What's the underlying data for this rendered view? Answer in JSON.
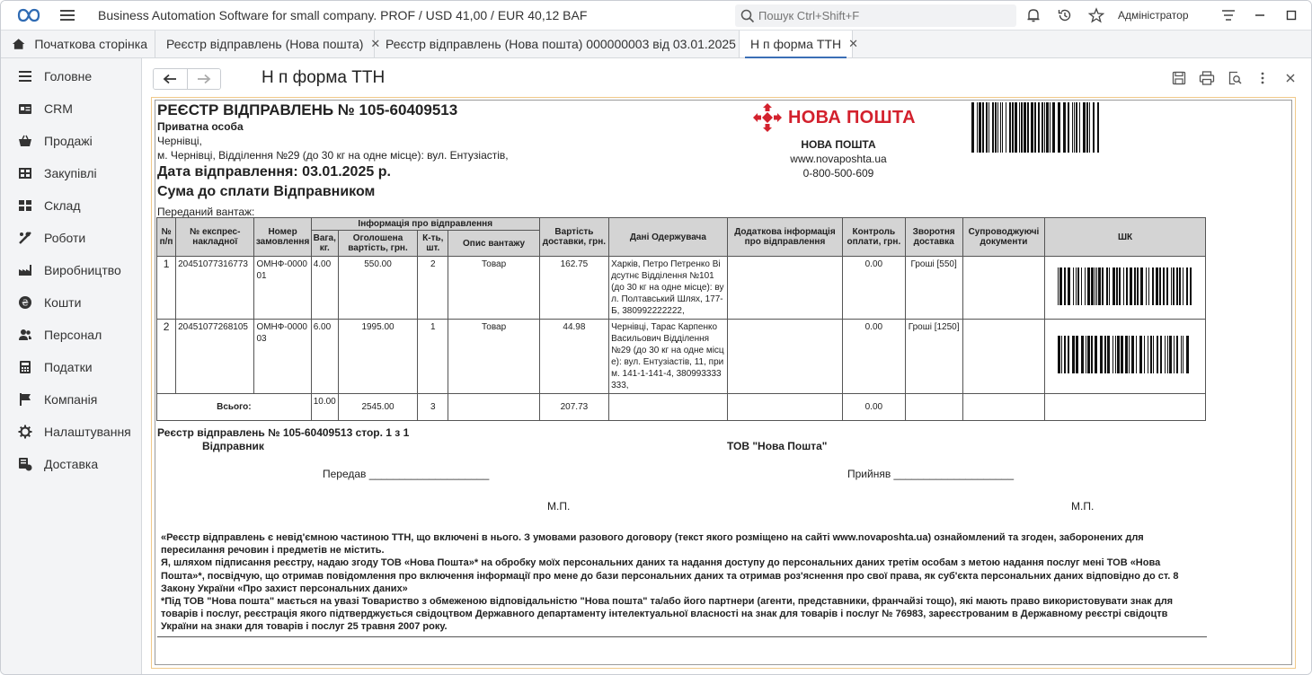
{
  "app": {
    "title": "Business Automation Software for small company. PROF / USD 41,00 / EUR 40,12 BAF",
    "search_placeholder": "Пошук Ctrl+Shift+F",
    "user": "Адміністратор"
  },
  "tabs": [
    {
      "label": "Початкова сторінка",
      "icon": "home-icon"
    },
    {
      "label": "Реєстр відправлень (Нова пошта)",
      "close": "✕"
    },
    {
      "label": "Реєстр відправлень (Нова пошта) 000000003 від 03.01.2025",
      "close": "✕"
    },
    {
      "label": "Н п форма ТТН",
      "close": "✕",
      "active": true
    }
  ],
  "sidebar": {
    "items": [
      {
        "label": "Головне",
        "icon": "menu-lines-icon"
      },
      {
        "label": "CRM",
        "icon": "crm-card-icon"
      },
      {
        "label": "Продажі",
        "icon": "basket-icon"
      },
      {
        "label": "Закупівлі",
        "icon": "cart-icon"
      },
      {
        "label": "Склад",
        "icon": "warehouse-icon"
      },
      {
        "label": "Роботи",
        "icon": "tools-icon"
      },
      {
        "label": "Виробництво",
        "icon": "factory-icon"
      },
      {
        "label": "Кошти",
        "icon": "money-icon"
      },
      {
        "label": "Персонал",
        "icon": "people-icon"
      },
      {
        "label": "Податки",
        "icon": "calculator-icon"
      },
      {
        "label": "Компанія",
        "icon": "flag-icon"
      },
      {
        "label": "Налаштування",
        "icon": "gear-icon"
      },
      {
        "label": "Доставка",
        "icon": "delivery-icon"
      }
    ]
  },
  "content": {
    "title": "Н п форма ТТН"
  },
  "document": {
    "title": "РЕЄСТР ВІДПРАВЛЕНЬ № 105-60409513",
    "sender_type": "Приватна особа",
    "city": "Чернівці,",
    "address": "м. Чернівці, Відділення №29 (до 30 кг на одне місце): вул. Ентузіастів,",
    "date": "Дата відправлення: 03.01.2025 р.",
    "payer": "Сума до сплати Відправником",
    "cargo_label": "Переданий вантаж:",
    "np_logo_text": "НОВА ПОШТА",
    "np_name": "НОВА ПОШТА",
    "np_site": "www.novaposhta.ua",
    "np_phone": "0-800-500-609",
    "colors": {
      "np_red": "#d3212d",
      "frame": "#f0c98a",
      "header_bg": "#d4d4d4"
    },
    "table": {
      "headers": {
        "num": "№ п/п",
        "express": "№ експрес-накладної",
        "order": "Номер замовлення",
        "info_group": "Інформація про відправлення",
        "weight": "Вага, кг.",
        "declared": "Оголошена вартість, грн.",
        "qty": "К-ть, шт.",
        "desc": "Опис вантажу",
        "cost": "Вартість доставки, грн.",
        "recipient": "Дані Одержувача",
        "extra": "Додаткова інформація про відправлення",
        "cod": "Контроль оплати, грн.",
        "return": "Зворотня доставка",
        "docs": "Супроводжуючі документи",
        "barcode": "ШК"
      },
      "rows": [
        {
          "num": "1",
          "express": "20451077316773",
          "order": "ОМНФ-000001",
          "weight": "4.00",
          "declared": "550.00",
          "qty": "2",
          "desc": "Товар",
          "cost": "162.75",
          "recipient": "Харків, Петро Петренко Відсутнє Відділення №101 (до 30 кг на одне місце): вул. Полтавський Шлях, 177-Б, 380992222222,",
          "extra": "",
          "cod": "0.00",
          "return": "Гроші [550]",
          "docs": ""
        },
        {
          "num": "2",
          "express": "20451077268105",
          "order": "ОМНФ-000003",
          "weight": "6.00",
          "declared": "1995.00",
          "qty": "1",
          "desc": "Товар",
          "cost": "44.98",
          "recipient": "Чернівці, Тарас Карпенко Васильович Відділення №29 (до 30 кг на одне місце): вул. Ентузіастів, 11, прим. 141-1-141-4, 380993333333,",
          "extra": "",
          "cod": "0.00",
          "return": "Гроші [1250]",
          "docs": ""
        }
      ],
      "totals": {
        "label": "Всього:",
        "weight": "10.00",
        "declared": "2545.00",
        "qty": "3",
        "cost": "207.73",
        "cod": "0.00"
      }
    },
    "footer": {
      "register_page": "Реєстр відправлень № 105-60409513 стор. 1 з 1",
      "sender_label": "Відправник",
      "carrier_label": "ТОВ \"Нова Пошта\"",
      "passed": "Передав ____________________",
      "accepted": "Прийняв ____________________",
      "mp": "М.П."
    },
    "legal": [
      "«Реєстр відправлень є невід'ємною частиною ТТН, що включені в нього. З умовами разового договору (текст якого розміщено на сайті www.novaposhta.ua) ознайомлений та згоден, заборонених для пересилання речовин і предметів не містить.",
      "Я, шляхом підписання реєстру, надаю згоду ТОВ «Нова Пошта»* на обробку моїх персональних даних та надання доступу до персональних даних третім особам з метою надання послуг мені ТОВ «Нова Пошта»*, посвідчую, що отримав повідомлення про включення інформації про мене до бази персональних даних та отримав роз'яснення про свої права, як суб'єкта персональних даних відповідно до ст. 8 Закону України «Про захист персональних даних»",
      "*Під ТОВ \"Нова пошта\" мається на увазі Товариство з обмеженою відповідальністю \"Нова пошта\" та/або його партнери (агенти, представники, франчайзі тощо), які мають право використовувати знак для товарів і послуг, реєстрація якого підтверджується свідоцтвом Державного департаменту інтелектуальної власності на знак для товарів і послуг № 76983, зареєстрованим в Державному реєстрі свідоцтв України на знаки для товарів і послуг 25 травня 2007 року."
    ]
  }
}
